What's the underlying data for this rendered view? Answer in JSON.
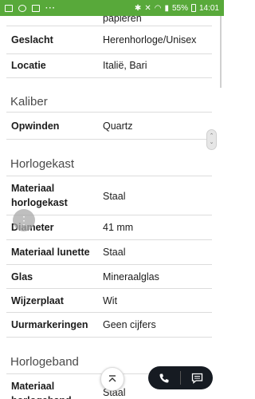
{
  "statusbar": {
    "battery": "55%",
    "time": "14:01",
    "dots": "···"
  },
  "rows": [
    {
      "label": "",
      "value": "papieren"
    },
    {
      "label": "Geslacht",
      "value": "Herenhorloge/Unisex"
    },
    {
      "label": "Locatie",
      "value": "Italië, Bari"
    },
    {
      "label": "Opwinden",
      "value": "Quartz"
    },
    {
      "label": "Materiaal horlogekast",
      "value": "Staal"
    },
    {
      "label": "Diameter",
      "value": "41 mm"
    },
    {
      "label": "Materiaal lunette",
      "value": "Staal"
    },
    {
      "label": "Glas",
      "value": "Mineraalglas"
    },
    {
      "label": "Wijzerplaat",
      "value": "Wit"
    },
    {
      "label": "Uurmarkeringen",
      "value": "Geen cijfers"
    },
    {
      "label": "Materiaal horlogeband",
      "value": "Staal"
    }
  ],
  "sections": {
    "kaliber": "Kaliber",
    "horlogekast": "Horlogekast",
    "horlogeband": "Horlogeband"
  },
  "icons": {
    "back_to_top": "chevron-up-icon",
    "phone": "phone-icon",
    "chat": "chat-icon",
    "more": "more-vertical-icon"
  },
  "colors": {
    "statusbar": "#58a93a",
    "contact_bar": "#161b22"
  }
}
